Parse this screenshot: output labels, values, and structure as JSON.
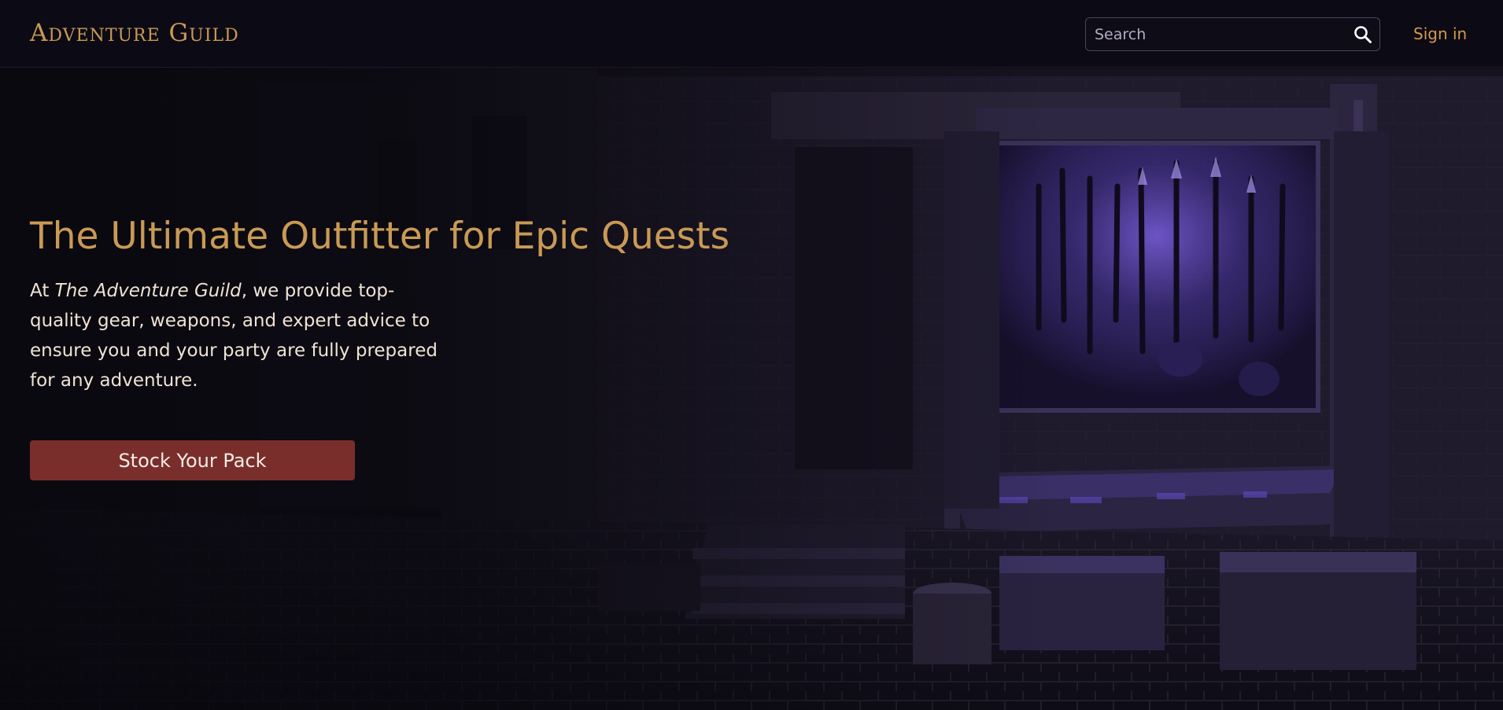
{
  "header": {
    "logo_text": "Adventure Guild",
    "search": {
      "placeholder": "Search",
      "value": "",
      "icon": "search-icon"
    },
    "sign_in_label": "Sign in"
  },
  "hero": {
    "title": "The Ultimate Outfitter for Epic Quests",
    "text_prefix": "At ",
    "text_emphasis": "The Adventure Guild",
    "text_suffix": ", we provide top-quality gear, weapons, and expert advice to ensure you and your party are fully prepared for any adventure.",
    "cta_label": "Stock Your Pack",
    "background_image": "dark cobblestone street with a weapon shop display lit in purple"
  },
  "colors": {
    "background": "#0c0a15",
    "accent_gold": "#c99a55",
    "sign_in": "#d39a4a",
    "cta_red": "#7a2e2c",
    "body_text": "#efe3d4",
    "shop_glow": "#6a4fd0"
  }
}
